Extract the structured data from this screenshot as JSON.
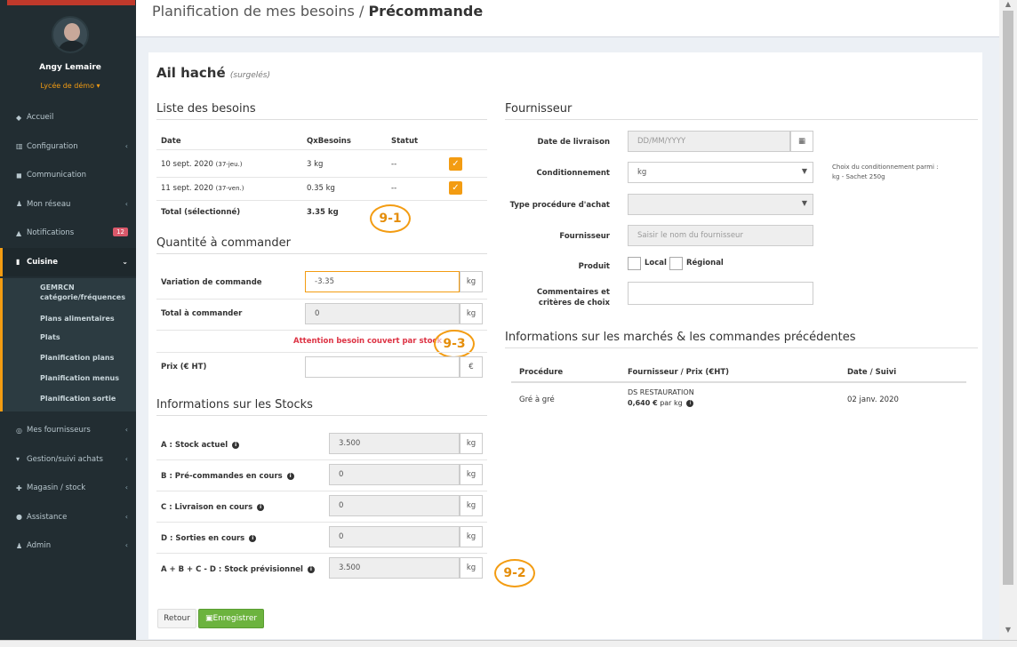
{
  "sidebar": {
    "user": "Angy Lemaire",
    "school": "Lycée de démo ▾",
    "nav": [
      {
        "icon": "◆",
        "label": "Accueil"
      },
      {
        "icon": "▥",
        "label": "Configuration",
        "chev": "‹"
      },
      {
        "icon": "◼",
        "label": "Communication"
      },
      {
        "icon": "♟",
        "label": "Mon réseau",
        "chev": "‹"
      },
      {
        "icon": "▲",
        "label": "Notifications",
        "badge": "12"
      },
      {
        "icon": "▮",
        "label": "Cuisine",
        "chev": "⌄"
      }
    ],
    "sub": [
      "GEMRCN catégorie/fréquences",
      "Plans alimentaires",
      "Plats",
      "Planification plans",
      "Planification menus",
      "Planification sortie"
    ],
    "nav2": [
      {
        "icon": "◎",
        "label": "Mes fournisseurs",
        "chev": "‹"
      },
      {
        "icon": "▾",
        "label": "Gestion/suivi achats",
        "chev": "‹"
      },
      {
        "icon": "✚",
        "label": "Magasin / stock",
        "chev": "‹"
      },
      {
        "icon": "●",
        "label": "Assistance",
        "chev": "‹"
      },
      {
        "icon": "♟",
        "label": "Admin",
        "chev": "‹"
      }
    ]
  },
  "header": {
    "crumb": "Planification de mes besoins / ",
    "title": "Précommande"
  },
  "product": {
    "name": "Ail haché",
    "category": "(surgelés)"
  },
  "needs": {
    "section": "Liste des besoins",
    "cols": [
      "Date",
      "QxBesoins",
      "Statut"
    ],
    "rows": [
      {
        "date": "10 sept. 2020",
        "day": "(37-jeu.)",
        "qty": "3 kg",
        "status": "--"
      },
      {
        "date": "11 sept. 2020",
        "day": "(37-ven.)",
        "qty": "0.35 kg",
        "status": "--"
      }
    ],
    "total_label": "Total (sélectionné)",
    "total_value": "3.35 kg"
  },
  "order": {
    "section": "Quantité à commander",
    "variation_label": "Variation de commande",
    "variation_value": "-3.35",
    "total_label": "Total à commander",
    "total_value": "0",
    "unit": "kg",
    "warning": "Attention besoin couvert par stock",
    "price_label": "Prix (€ HT)",
    "price_unit": "€"
  },
  "stocks": {
    "section": "Informations sur les Stocks",
    "rows": [
      {
        "label": "A : Stock actuel",
        "value": "3.500"
      },
      {
        "label": "B : Pré-commandes en cours",
        "value": "0"
      },
      {
        "label": "C : Livraison en cours",
        "value": "0"
      },
      {
        "label": "D : Sorties en cours",
        "value": "0"
      },
      {
        "label": "A + B + C - D : Stock prévisionnel",
        "value": "3.500"
      }
    ],
    "unit": "kg"
  },
  "supplier": {
    "section": "Fournisseur",
    "delivery_label": "Date de livraison",
    "delivery_placeholder": "DD/MM/YYYY",
    "pack_label": "Conditionnement",
    "pack_value": "kg",
    "pack_help": "Choix du conditionnement parmi :",
    "pack_help2": "kg - Sachet 250g",
    "proc_label": "Type procédure d'achat",
    "supplier_label": "Fournisseur",
    "supplier_placeholder": "Saisir le nom du fournisseur",
    "product_label": "Produit",
    "local": "Local",
    "regional": "Régional",
    "comments_label": "Commentaires et critères de choix"
  },
  "market": {
    "section": "Informations sur les marchés & les commandes précédentes",
    "cols": [
      "Procédure",
      "Fournisseur / Prix (€HT)",
      "Date / Suivi"
    ],
    "row": {
      "procedure": "Gré à gré",
      "supplier": "DS RESTAURATION",
      "price": "0,640 €",
      "per": "par kg",
      "date": "02 janv. 2020"
    }
  },
  "buttons": {
    "back": "Retour",
    "save": "Enregistrer"
  },
  "annotations": {
    "a": "9-1",
    "b": "9-3",
    "c": "9-2"
  }
}
